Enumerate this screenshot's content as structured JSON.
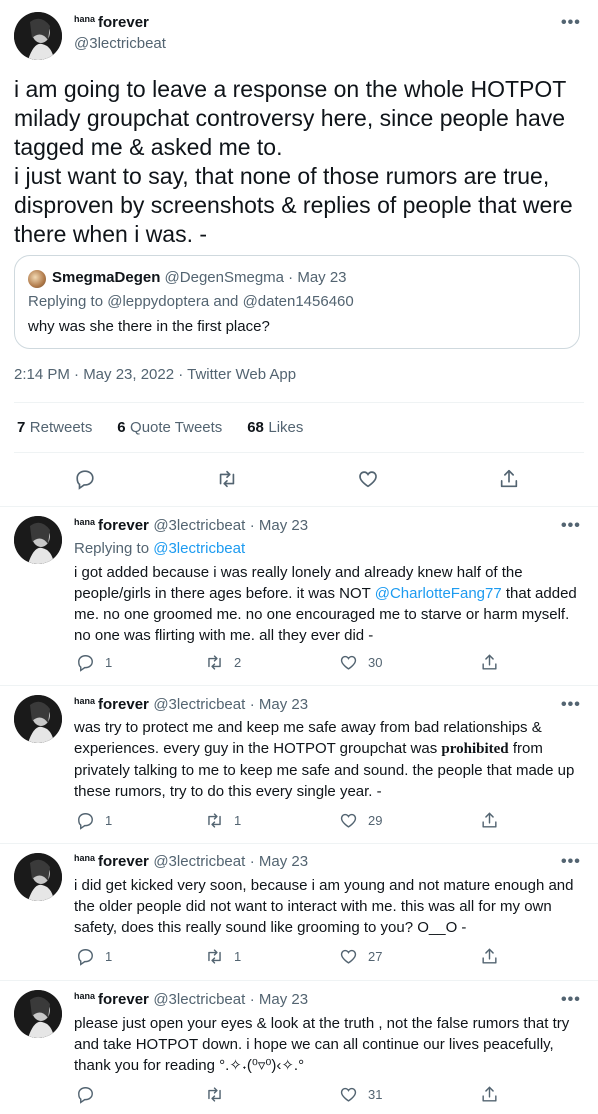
{
  "main_tweet": {
    "name_sup": "hana",
    "name": "forever",
    "handle": "@3lectricbeat",
    "text": "i am going to leave a response on the whole HOTPOT milady groupchat controversy here, since people have tagged me & asked me to.\ni just want to say, that none of those rumors are true, disproven by screenshots & replies of people that were there when i was. -",
    "quote": {
      "name": "SmegmaDegen",
      "handle": "@DegenSmegma",
      "date": "· May 23",
      "replying_prefix": "Replying to",
      "replying_to_1": "@leppydoptera",
      "replying_and": "and",
      "replying_to_2": "@daten1456460",
      "text": "why was she there in the first place?"
    },
    "timestamp": "2:14 PM · May 23, 2022 · Twitter Web App",
    "stats": {
      "retweets_count": "7",
      "retweets_label": "Retweets",
      "quotes_count": "6",
      "quotes_label": "Quote Tweets",
      "likes_count": "68",
      "likes_label": "Likes"
    }
  },
  "replies": [
    {
      "name_sup": "hana",
      "name": "forever",
      "handle": "@3lectricbeat",
      "date": "· May 23",
      "replying_prefix": "Replying to",
      "replying_to": "@3lectricbeat",
      "text_1": "i got added because i was really lonely and already knew half of the people/girls in there ages before. it was NOT ",
      "mention": "@CharlotteFang77",
      "text_2": " that added me. no one groomed me. no one encouraged me to starve or harm myself. no one was flirting with me. all they ever did -",
      "replies": "1",
      "retweets": "2",
      "likes": "30"
    },
    {
      "name_sup": "hana",
      "name": "forever",
      "handle": "@3lectricbeat",
      "date": "· May 23",
      "text_1": "was try to protect me and keep me safe away from bad relationships & experiences. every guy in the HOTPOT groupchat was ",
      "bold_word": "prohibited",
      "text_2": " from privately talking to me to keep me safe and sound. the people that made up these rumors, try to do this every single year. -",
      "replies": "1",
      "retweets": "1",
      "likes": "29"
    },
    {
      "name_sup": "hana",
      "name": "forever",
      "handle": "@3lectricbeat",
      "date": "· May 23",
      "text": "i did get kicked very soon, because i am young and not mature enough and the older people did not want to interact with me. this was all for my own safety, does this really sound like grooming to you? O__O -",
      "replies": "1",
      "retweets": "1",
      "likes": "27"
    },
    {
      "name_sup": "hana",
      "name": "forever",
      "handle": "@3lectricbeat",
      "date": "· May 23",
      "text": "please just open your eyes & look at the truth , not the false rumors that try and take HOTPOT down. i hope we can all continue our lives peacefully, thank you for reading °.✧˖(⁰▿⁰)‹✧.°",
      "likes": "31"
    }
  ],
  "more_label": "•••",
  "colors": {
    "text": "#0f1419",
    "secondary": "#536471",
    "link": "#1d9bf0",
    "border": "#cfd9de",
    "divider": "#eff3f4"
  }
}
